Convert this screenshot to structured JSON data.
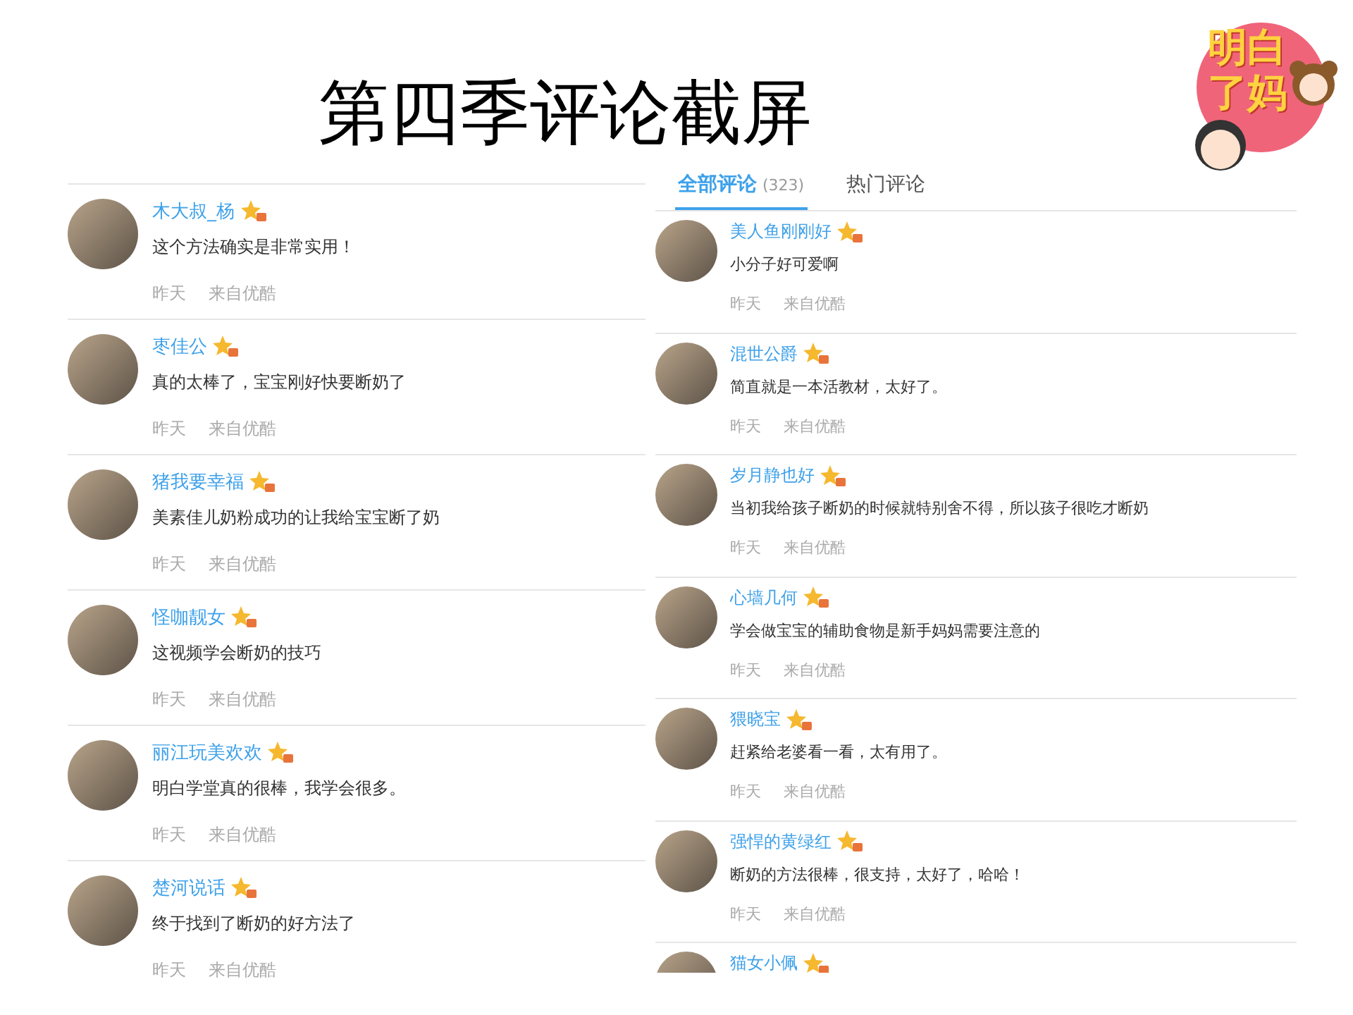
{
  "title": "第四季评论截屏",
  "logo": {
    "text": "明白了妈"
  },
  "left_panel": {
    "comments": [
      {
        "user": "木大叔_杨",
        "text": "这个方法确实是非常实用！",
        "time": "昨天",
        "source": "来自优酷"
      },
      {
        "user": "枣佳公",
        "text": "真的太棒了，宝宝刚好快要断奶了",
        "time": "昨天",
        "source": "来自优酷"
      },
      {
        "user": "猪我要幸福",
        "text": "美素佳儿奶粉成功的让我给宝宝断了奶",
        "time": "昨天",
        "source": "来自优酷"
      },
      {
        "user": "怪咖靓女",
        "text": "这视频学会断奶的技巧",
        "time": "昨天",
        "source": "来自优酷"
      },
      {
        "user": "丽江玩美欢欢",
        "text": "明白学堂真的很棒，我学会很多。",
        "time": "昨天",
        "source": "来自优酷"
      },
      {
        "user": "楚河说话",
        "text": "终于找到了断奶的好方法了",
        "time": "昨天",
        "source": "来自优酷"
      }
    ]
  },
  "right_panel": {
    "tabs": [
      {
        "label": "全部评论",
        "count": "(323)",
        "selected": true
      },
      {
        "label": "热门评论",
        "selected": false
      }
    ],
    "comments": [
      {
        "user": "美人鱼刚刚好",
        "text": "小分子好可爱啊",
        "time": "昨天",
        "source": "来自优酷"
      },
      {
        "user": "混世公爵",
        "text": "简直就是一本活教材，太好了。",
        "time": "昨天",
        "source": "来自优酷"
      },
      {
        "user": "岁月静也好",
        "text": "当初我给孩子断奶的时候就特别舍不得，所以孩子很吃才断奶",
        "time": "昨天",
        "source": "来自优酷"
      },
      {
        "user": "心墙几何",
        "text": "学会做宝宝的辅助食物是新手妈妈需要注意的",
        "time": "昨天",
        "source": "来自优酷"
      },
      {
        "user": "猥晓宝",
        "text": "赶紧给老婆看一看，太有用了。",
        "time": "昨天",
        "source": "来自优酷"
      },
      {
        "user": "强悍的黄绿红",
        "text": "断奶的方法很棒，很支持，太好了，哈哈！",
        "time": "昨天",
        "source": "来自优酷"
      },
      {
        "user": "猫女小佩"
      }
    ]
  }
}
